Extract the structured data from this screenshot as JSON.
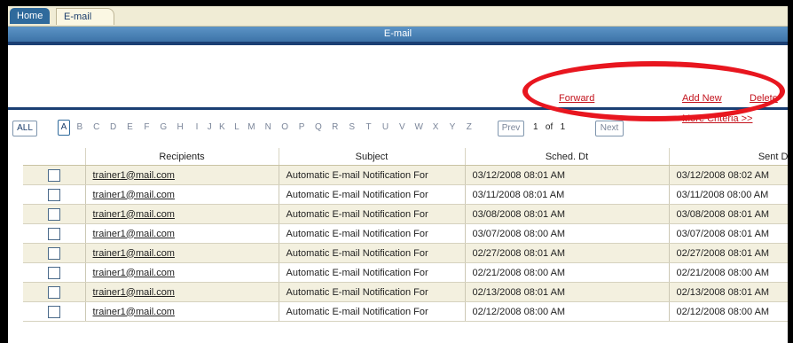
{
  "tabs": {
    "home": "Home",
    "email": "E-mail"
  },
  "title_bar": "E-mail",
  "actions": {
    "forward": "Forward",
    "add_new": "Add New",
    "delete": "Delete"
  },
  "filter": {
    "all_label": "ALL",
    "letters": [
      "A",
      "B",
      "C",
      "D",
      "E",
      "F",
      "G",
      "H",
      "I",
      "J",
      "K",
      "L",
      "M",
      "N",
      "O",
      "P",
      "Q",
      "R",
      "S",
      "T",
      "U",
      "V",
      "W",
      "X",
      "Y",
      "Z"
    ],
    "active_letter": "A",
    "prev_label": "Prev",
    "page": "1",
    "of_label": "of",
    "total_pages": "1",
    "next_label": "Next",
    "more_criteria": "More Criteria >>"
  },
  "table": {
    "columns": [
      "",
      "Recipients",
      "Subject",
      "Sched. Dt",
      "Sent Dt"
    ],
    "rows": [
      {
        "recipient": "trainer1@mail.com",
        "subject": "Automatic E-mail Notification For",
        "sched": "03/12/2008 08:01 AM",
        "sent": "03/12/2008 08:02 AM"
      },
      {
        "recipient": "trainer1@mail.com",
        "subject": "Automatic E-mail Notification For",
        "sched": "03/11/2008 08:01 AM",
        "sent": "03/11/2008 08:00 AM"
      },
      {
        "recipient": "trainer1@mail.com",
        "subject": "Automatic E-mail Notification For",
        "sched": "03/08/2008 08:01 AM",
        "sent": "03/08/2008 08:01 AM"
      },
      {
        "recipient": "trainer1@mail.com",
        "subject": "Automatic E-mail Notification For",
        "sched": "03/07/2008 08:00 AM",
        "sent": "03/07/2008 08:01 AM"
      },
      {
        "recipient": "trainer1@mail.com",
        "subject": "Automatic E-mail Notification For",
        "sched": "02/27/2008 08:01 AM",
        "sent": "02/27/2008 08:01 AM"
      },
      {
        "recipient": "trainer1@mail.com",
        "subject": "Automatic E-mail Notification For",
        "sched": "02/21/2008 08:00 AM",
        "sent": "02/21/2008 08:00 AM"
      },
      {
        "recipient": "trainer1@mail.com",
        "subject": "Automatic E-mail Notification For",
        "sched": "02/13/2008 08:01 AM",
        "sent": "02/13/2008 08:01 AM"
      },
      {
        "recipient": "trainer1@mail.com",
        "subject": "Automatic E-mail Notification For",
        "sched": "02/12/2008 08:00 AM",
        "sent": "02/12/2008 08:00 AM"
      }
    ]
  },
  "colors": {
    "accent": "#2f6a9c",
    "title_bar": "#4a82b8",
    "link": "#c3121c",
    "annotation": "#e8161f",
    "row_alt": "#f3f0df"
  }
}
